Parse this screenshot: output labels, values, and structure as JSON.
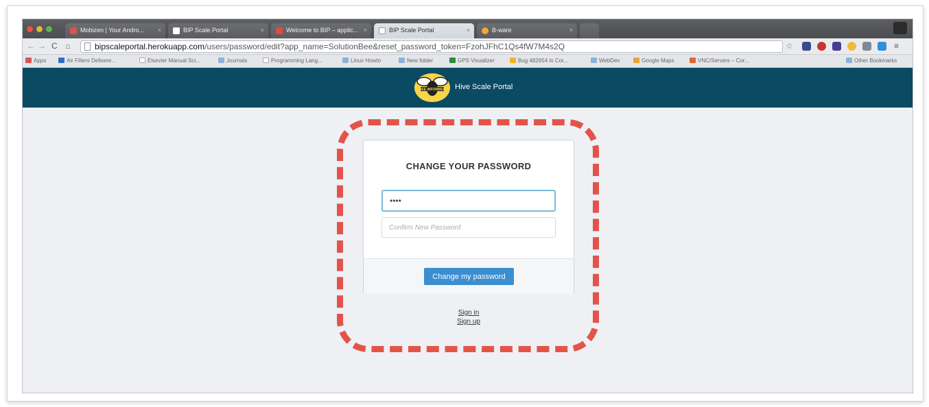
{
  "browser": {
    "tabs": [
      {
        "title": "Mobizen | Your Andro...",
        "fav_color": "#d9534f"
      },
      {
        "title": "BIP Scale Portal",
        "fav_color": "#ffffff"
      },
      {
        "title": "Welcome to BIP – applic...",
        "fav_color": "#e04b3f"
      },
      {
        "title": "BIP Scale Portal",
        "fav_color": "#ffffff"
      },
      {
        "title": "B-ware",
        "fav_color": "#f0a830"
      }
    ],
    "url_host": "bipscaleportal.herokuapp.com",
    "url_path": "/users/password/edit?app_name=SolutionBee&reset_password_token=FzohJFhC1Qs4fW7M4s2Q",
    "bookmarks": [
      "Apps",
      "Air Filters Delivere...",
      "Elsevier Manual Sci...",
      "Journals",
      "Programming Lang...",
      "Linux Howto",
      "New folder",
      "GPS Visualizer",
      "Bug 482654 in Cor...",
      "WebDev",
      "Google Maps",
      "VNC/Servers – Cor...",
      "Other Bookmarks"
    ]
  },
  "site": {
    "logo_text": "BEE INFORMED",
    "brand": "Hive Scale Portal",
    "header_color": "#0b4a63"
  },
  "form": {
    "title": "CHANGE YOUR PASSWORD",
    "password_value": "••••",
    "confirm_placeholder": "Confirm New Password",
    "submit_label": "Change my password",
    "button_color": "#3b8ed0"
  },
  "links": {
    "sign_in": "Sign in",
    "sign_up": "Sign up"
  },
  "highlight_color": "#e2544a"
}
